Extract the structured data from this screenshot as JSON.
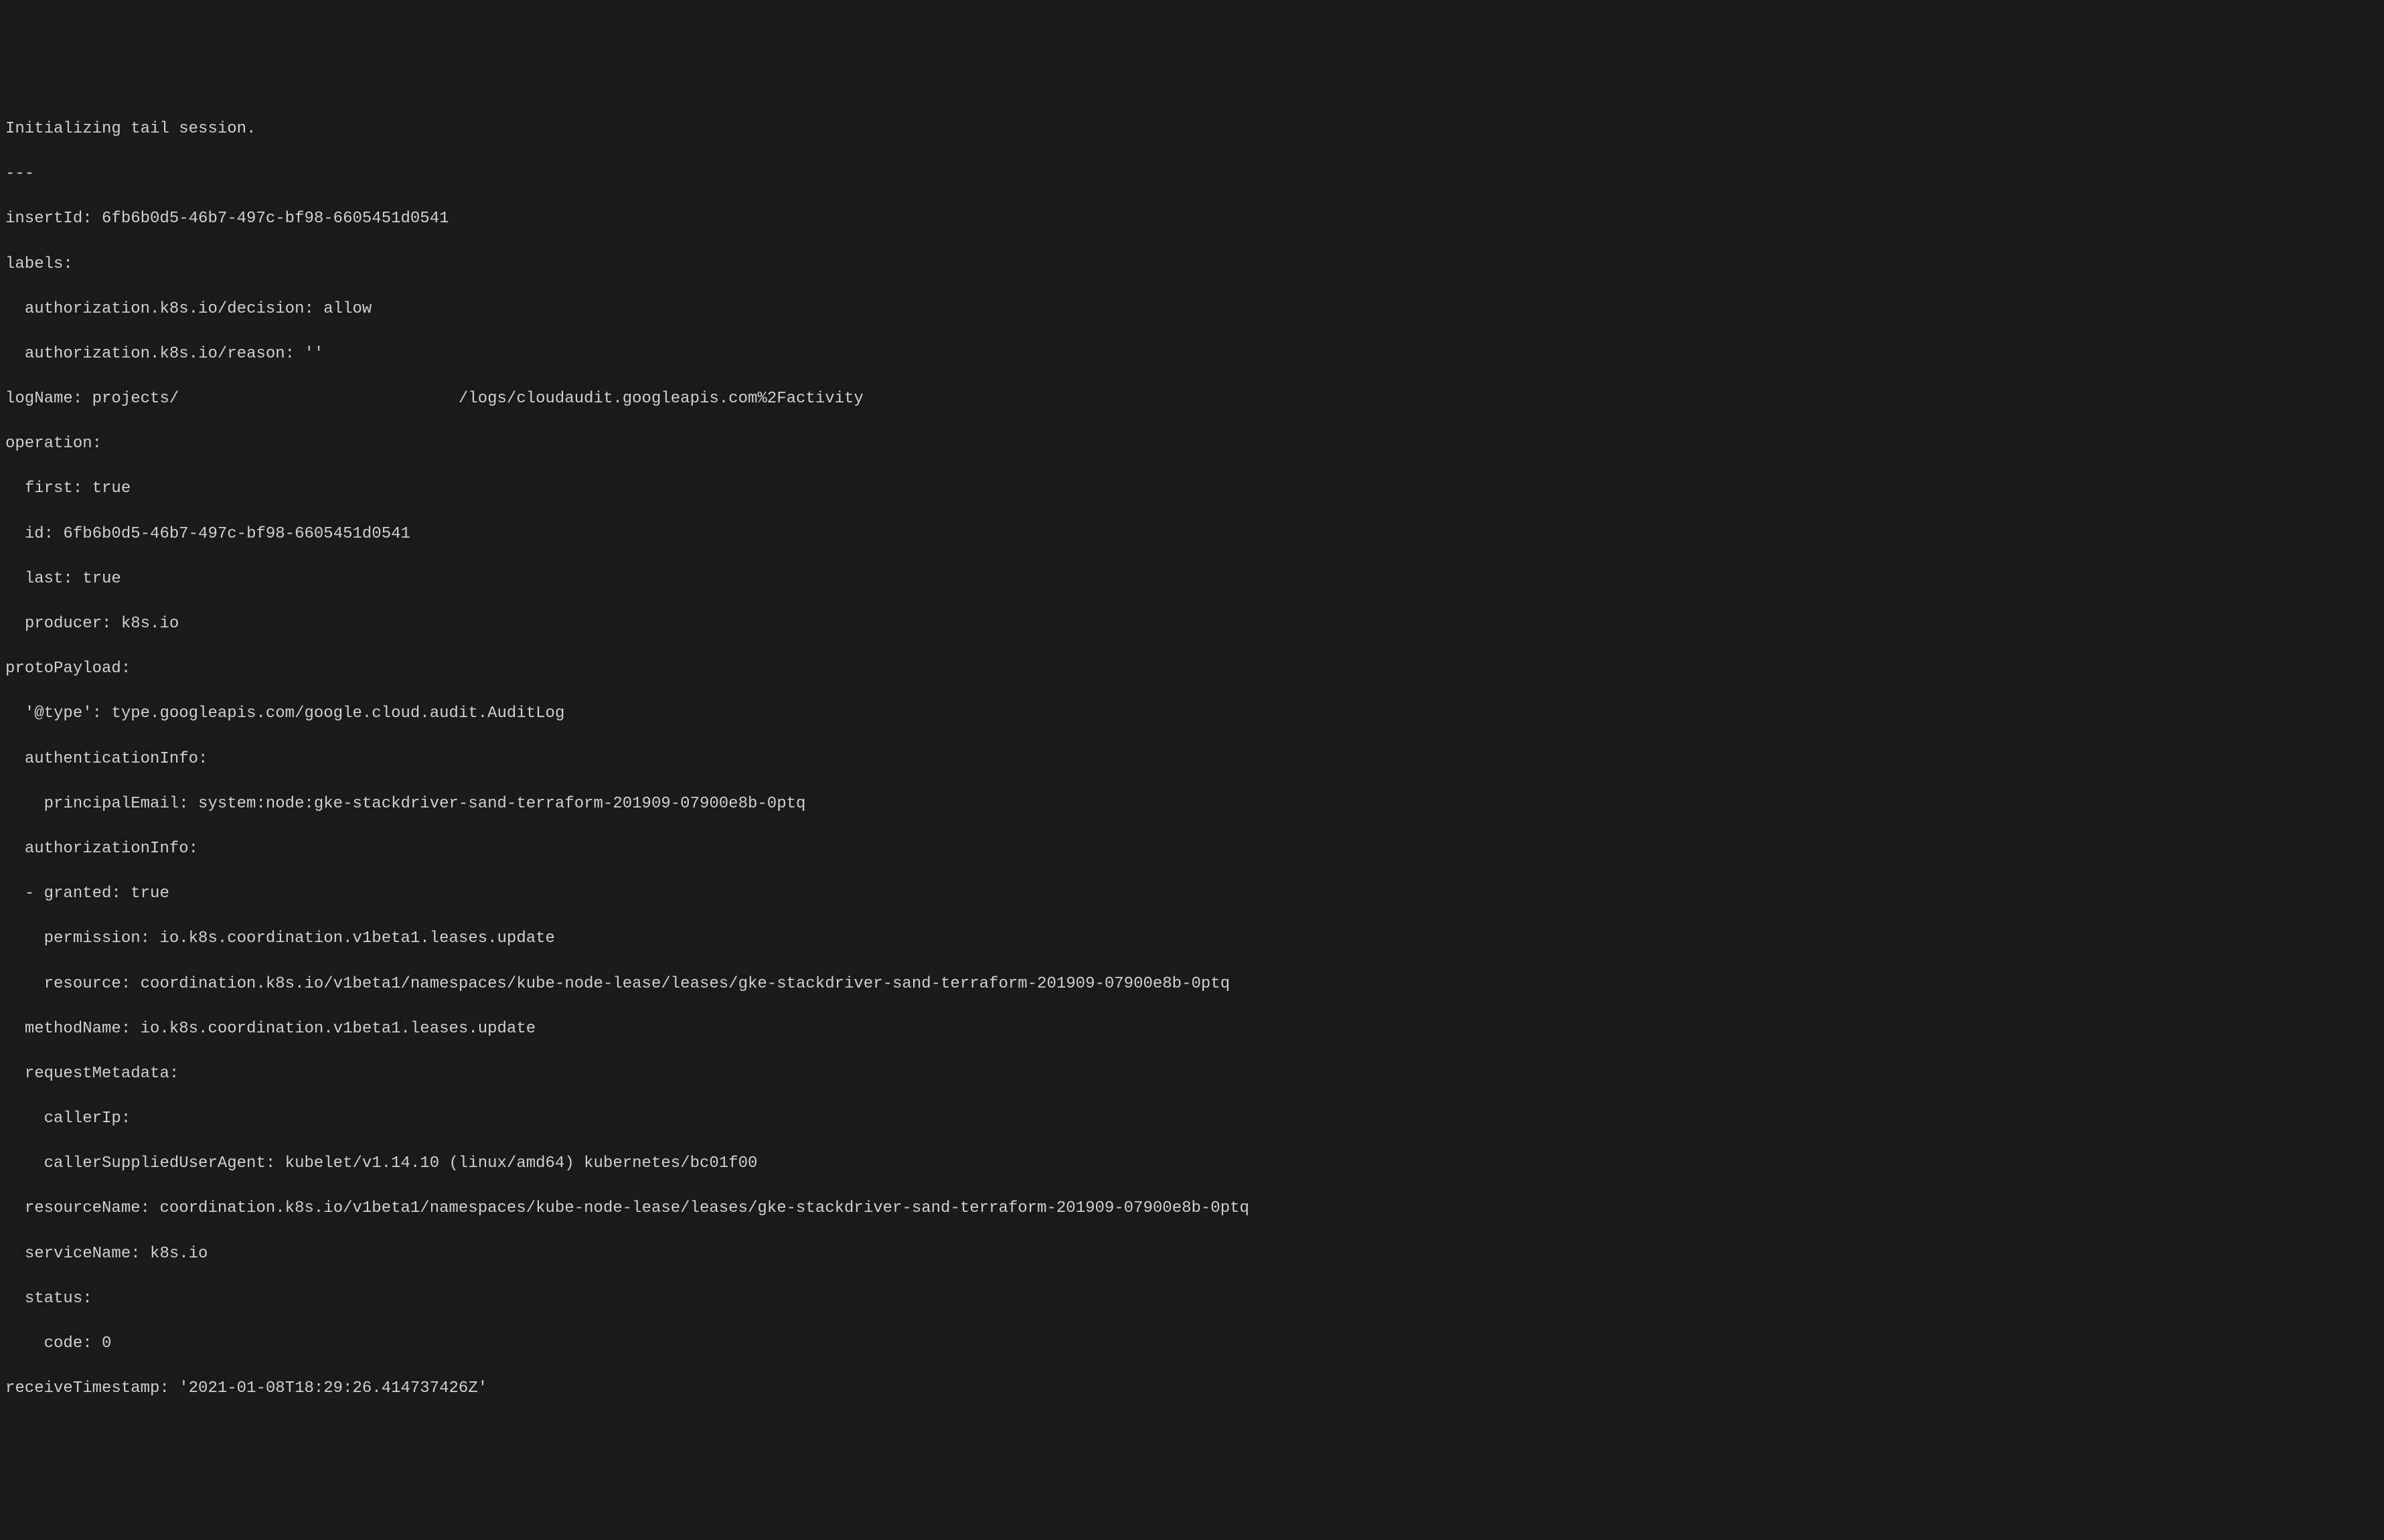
{
  "terminal": {
    "lines": [
      "Initializing tail session.",
      "---",
      "insertId: 6fb6b0d5-46b7-497c-bf98-6605451d0541",
      "labels:",
      "  authorization.k8s.io/decision: allow",
      "  authorization.k8s.io/reason: ''",
      "logName: projects/                             /logs/cloudaudit.googleapis.com%2Factivity",
      "operation:",
      "  first: true",
      "  id: 6fb6b0d5-46b7-497c-bf98-6605451d0541",
      "  last: true",
      "  producer: k8s.io",
      "protoPayload:",
      "  '@type': type.googleapis.com/google.cloud.audit.AuditLog",
      "  authenticationInfo:",
      "    principalEmail: system:node:gke-stackdriver-sand-terraform-201909-07900e8b-0ptq",
      "  authorizationInfo:",
      "  - granted: true",
      "    permission: io.k8s.coordination.v1beta1.leases.update",
      "    resource: coordination.k8s.io/v1beta1/namespaces/kube-node-lease/leases/gke-stackdriver-sand-terraform-201909-07900e8b-0ptq",
      "  methodName: io.k8s.coordination.v1beta1.leases.update",
      "  requestMetadata:",
      "    callerIp:",
      "    callerSuppliedUserAgent: kubelet/v1.14.10 (linux/amd64) kubernetes/bc01f00",
      "  resourceName: coordination.k8s.io/v1beta1/namespaces/kube-node-lease/leases/gke-stackdriver-sand-terraform-201909-07900e8b-0ptq",
      "  serviceName: k8s.io",
      "  status:",
      "    code: 0",
      "receiveTimestamp: '2021-01-08T18:29:26.414737426Z'"
    ]
  }
}
